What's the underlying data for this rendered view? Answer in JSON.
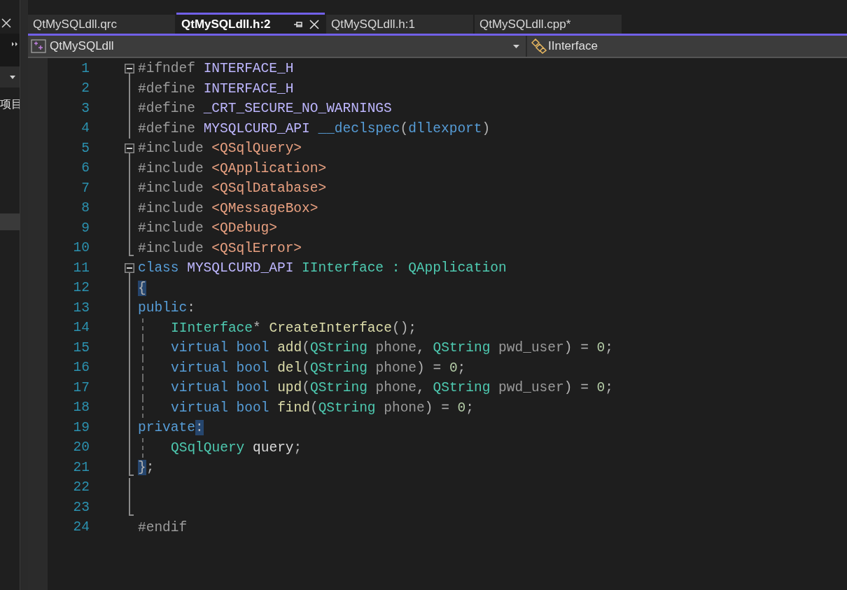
{
  "side_panel": {
    "label": "项目"
  },
  "tabs": [
    {
      "label": "QtMySQLdll.qrc",
      "selected": false,
      "pinned": false
    },
    {
      "label": "QtMySQLdll.h:2",
      "selected": true,
      "pinned": true
    },
    {
      "label": "QtMySQLdll.h:1",
      "selected": false,
      "pinned": false
    },
    {
      "label": "QtMySQLdll.cpp*",
      "selected": false,
      "pinned": false
    }
  ],
  "navigation": {
    "project": "QtMySQLdll",
    "scope": "IInterface"
  },
  "lines": [
    {
      "number": "1",
      "kind": "foldstart",
      "indent": false,
      "tokens": [
        {
          "kind": "pre",
          "text": "#ifndef "
        },
        {
          "kind": "macro",
          "text": "INTERFACE_H"
        }
      ]
    },
    {
      "number": "2",
      "kind": "foldbody",
      "indent": false,
      "tokens": [
        {
          "kind": "pre",
          "text": "#define "
        },
        {
          "kind": "macro",
          "text": "INTERFACE_H"
        }
      ]
    },
    {
      "number": "3",
      "kind": "foldbody",
      "indent": false,
      "tokens": [
        {
          "kind": "pre",
          "text": "#define "
        },
        {
          "kind": "macro",
          "text": "_CRT_SECURE_NO_WARNINGS"
        }
      ]
    },
    {
      "number": "4",
      "kind": "foldbody",
      "indent": false,
      "tokens": [
        {
          "kind": "pre",
          "text": "#define "
        },
        {
          "kind": "macro",
          "text": "MYSQLCURD_API "
        },
        {
          "kind": "keyword",
          "text": "__declspec"
        },
        {
          "kind": "punct",
          "text": "("
        },
        {
          "kind": "keyword",
          "text": "dllexport"
        },
        {
          "kind": "punct",
          "text": ")"
        }
      ]
    },
    {
      "number": "5",
      "kind": "foldstart",
      "indent": false,
      "tokens": [
        {
          "kind": "pre",
          "text": "#include "
        },
        {
          "kind": "header",
          "text": "<QSqlQuery>"
        }
      ]
    },
    {
      "number": "6",
      "kind": "foldbody",
      "indent": false,
      "tokens": [
        {
          "kind": "pre",
          "text": "#include "
        },
        {
          "kind": "header",
          "text": "<QApplication>"
        }
      ]
    },
    {
      "number": "7",
      "kind": "foldbody",
      "indent": false,
      "tokens": [
        {
          "kind": "pre",
          "text": "#include "
        },
        {
          "kind": "header",
          "text": "<QSqlDatabase>"
        }
      ]
    },
    {
      "number": "8",
      "kind": "foldbody",
      "indent": false,
      "tokens": [
        {
          "kind": "pre",
          "text": "#include "
        },
        {
          "kind": "header",
          "text": "<QMessageBox>"
        }
      ]
    },
    {
      "number": "9",
      "kind": "foldbody",
      "indent": false,
      "tokens": [
        {
          "kind": "pre",
          "text": "#include "
        },
        {
          "kind": "header",
          "text": "<QDebug>"
        }
      ]
    },
    {
      "number": "10",
      "kind": "foldend",
      "indent": false,
      "tokens": [
        {
          "kind": "pre",
          "text": "#include "
        },
        {
          "kind": "header",
          "text": "<QSqlError>"
        }
      ]
    },
    {
      "number": "11",
      "kind": "foldstart",
      "indent": false,
      "tokens": [
        {
          "kind": "keyword",
          "text": "class "
        },
        {
          "kind": "macro",
          "text": "MYSQLCURD_API "
        },
        {
          "kind": "type",
          "text": "IInterface : QApplication"
        }
      ]
    },
    {
      "number": "12",
      "kind": "foldbody",
      "indent": false,
      "tokens": [
        {
          "kind": "match",
          "text": "{"
        }
      ]
    },
    {
      "number": "13",
      "kind": "foldbody",
      "indent": false,
      "tokens": [
        {
          "kind": "keyword",
          "text": "public"
        },
        {
          "kind": "punct",
          "text": ":"
        }
      ]
    },
    {
      "number": "14",
      "kind": "foldbody",
      "indent": true,
      "tokens": [
        {
          "kind": "type",
          "text": "IInterface"
        },
        {
          "kind": "punct",
          "text": "* "
        },
        {
          "kind": "function",
          "text": "CreateInterface"
        },
        {
          "kind": "punct",
          "text": "();"
        }
      ]
    },
    {
      "number": "15",
      "kind": "foldbody",
      "indent": true,
      "tokens": [
        {
          "kind": "keyword",
          "text": "virtual bool "
        },
        {
          "kind": "function",
          "text": "add"
        },
        {
          "kind": "punct",
          "text": "("
        },
        {
          "kind": "type",
          "text": "QString "
        },
        {
          "kind": "param",
          "text": "phone"
        },
        {
          "kind": "punct",
          "text": ", "
        },
        {
          "kind": "type",
          "text": "QString "
        },
        {
          "kind": "param",
          "text": "pwd_user"
        },
        {
          "kind": "punct",
          "text": ") = "
        },
        {
          "kind": "number",
          "text": "0"
        },
        {
          "kind": "punct",
          "text": ";"
        }
      ]
    },
    {
      "number": "16",
      "kind": "foldbody",
      "indent": true,
      "tokens": [
        {
          "kind": "keyword",
          "text": "virtual bool "
        },
        {
          "kind": "function",
          "text": "del"
        },
        {
          "kind": "punct",
          "text": "("
        },
        {
          "kind": "type",
          "text": "QString "
        },
        {
          "kind": "param",
          "text": "phone"
        },
        {
          "kind": "punct",
          "text": ") = "
        },
        {
          "kind": "number",
          "text": "0"
        },
        {
          "kind": "punct",
          "text": ";"
        }
      ]
    },
    {
      "number": "17",
      "kind": "foldbody",
      "indent": true,
      "tokens": [
        {
          "kind": "keyword",
          "text": "virtual bool "
        },
        {
          "kind": "function",
          "text": "upd"
        },
        {
          "kind": "punct",
          "text": "("
        },
        {
          "kind": "type",
          "text": "QString "
        },
        {
          "kind": "param",
          "text": "phone"
        },
        {
          "kind": "punct",
          "text": ", "
        },
        {
          "kind": "type",
          "text": "QString "
        },
        {
          "kind": "param",
          "text": "pwd_user"
        },
        {
          "kind": "punct",
          "text": ") = "
        },
        {
          "kind": "number",
          "text": "0"
        },
        {
          "kind": "punct",
          "text": ";"
        }
      ]
    },
    {
      "number": "18",
      "kind": "foldbody",
      "indent": true,
      "tokens": [
        {
          "kind": "keyword",
          "text": "virtual bool "
        },
        {
          "kind": "function",
          "text": "find"
        },
        {
          "kind": "punct",
          "text": "("
        },
        {
          "kind": "type",
          "text": "QString "
        },
        {
          "kind": "param",
          "text": "phone"
        },
        {
          "kind": "punct",
          "text": ") = "
        },
        {
          "kind": "number",
          "text": "0"
        },
        {
          "kind": "punct",
          "text": ";"
        }
      ]
    },
    {
      "number": "19",
      "kind": "foldbody",
      "indent": false,
      "tokens": [
        {
          "kind": "keyword",
          "text": "private"
        },
        {
          "kind": "match",
          "text": ":"
        }
      ]
    },
    {
      "number": "20",
      "kind": "foldbody",
      "indent": true,
      "tokens": [
        {
          "kind": "type",
          "text": "QSqlQuery "
        },
        {
          "kind": "ident",
          "text": "query"
        },
        {
          "kind": "punct",
          "text": ";"
        }
      ]
    },
    {
      "number": "21",
      "kind": "foldend",
      "indent": false,
      "tokens": [
        {
          "kind": "match",
          "text": "}"
        },
        {
          "kind": "punct",
          "text": ";"
        }
      ]
    },
    {
      "number": "22",
      "kind": "foldbody",
      "indent": false
    },
    {
      "number": "23",
      "kind": "foldend",
      "indent": false
    },
    {
      "number": "24",
      "kind": "plain",
      "indent": false,
      "tokens": [
        {
          "kind": "pre",
          "text": "#endif"
        }
      ]
    }
  ]
}
